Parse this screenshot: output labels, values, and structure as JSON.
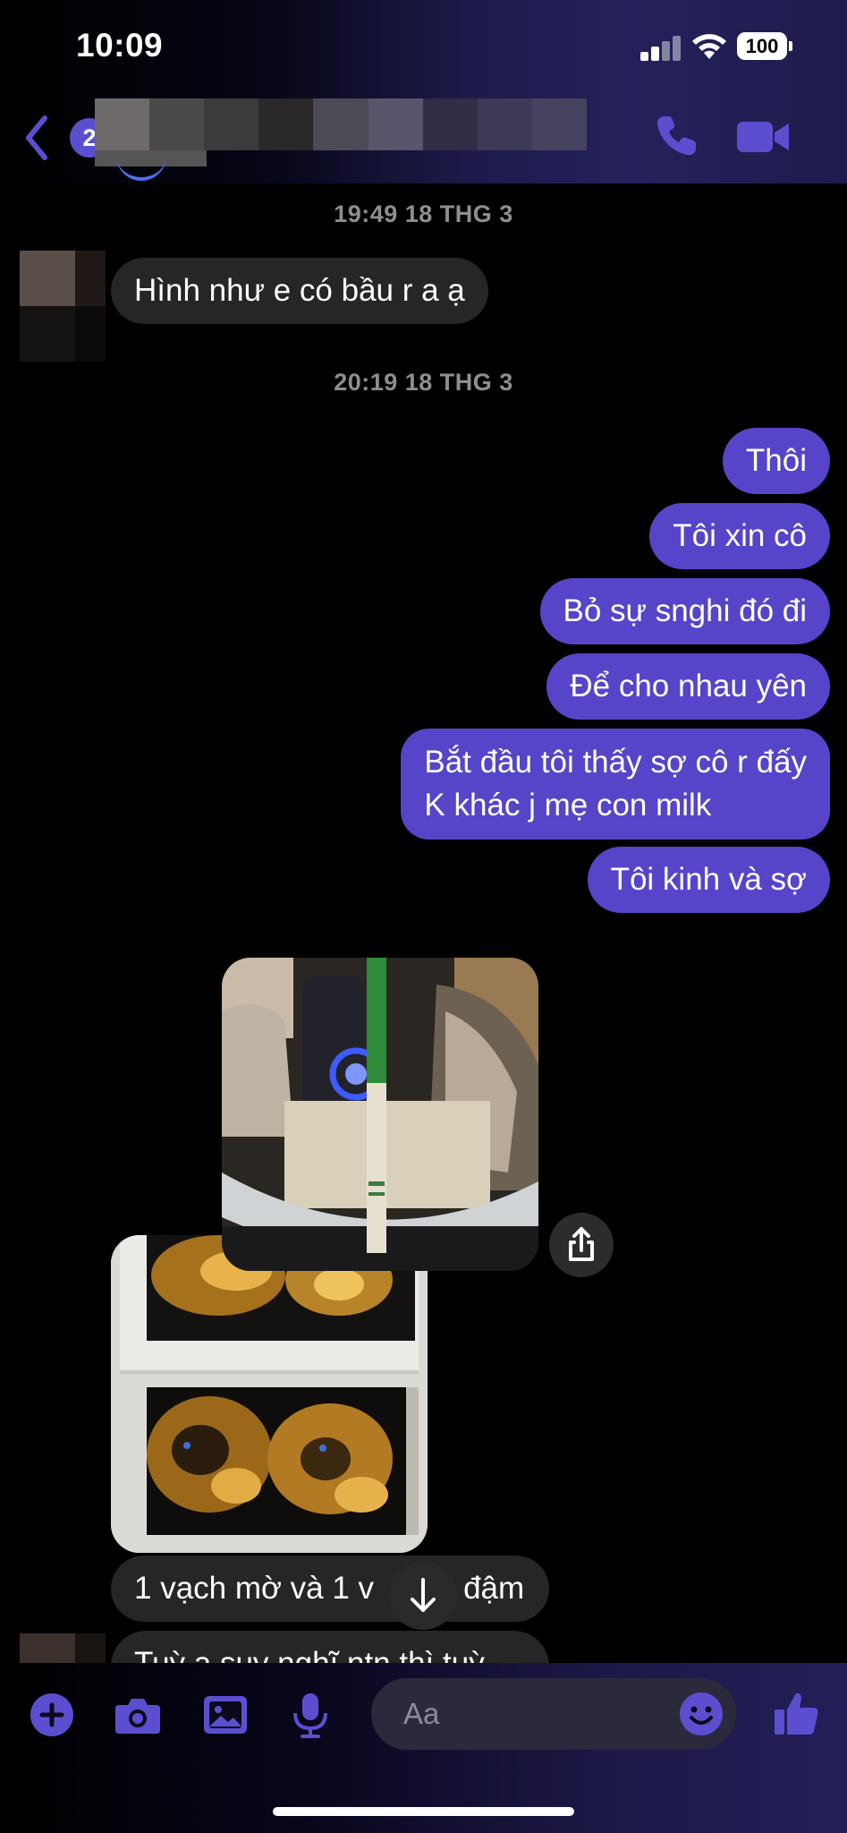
{
  "status_bar": {
    "time": "10:09",
    "battery": "100"
  },
  "header": {
    "unread_count": "2",
    "icons": [
      "back-chevron-icon",
      "phone-icon",
      "video-camera-icon"
    ]
  },
  "conversation": {
    "timestamps": [
      "19:49 18 THG 3",
      "20:19 18 THG 3"
    ],
    "incoming": [
      "Hình như e có bầu r a ạ",
      "1 vạch mờ và 1 v",
      "đậm",
      "Tuỳ a suy nghĩ ntn thì tuỳ"
    ],
    "outgoing": [
      "Thôi",
      "Tôi xin cô",
      "Bỏ sự snghi đó đi",
      "Để cho nhau yên",
      "Bắt đầu tôi thấy sợ cô r đấy",
      "K khác j mẹ con milk",
      "Tôi kinh và sợ"
    ],
    "photos": [
      "pregnancy-test-photo",
      "ultrasound-scan-photo"
    ]
  },
  "composer": {
    "placeholder": "Aa",
    "tools": [
      "plus-icon",
      "camera-icon",
      "image-icon",
      "microphone-icon",
      "emoji-icon",
      "thumbs-up-icon"
    ]
  },
  "colors": {
    "outgoing_bubble": "#5645c8",
    "incoming_bubble": "#262628",
    "accent": "#5b4fd0",
    "background": "#000000"
  }
}
